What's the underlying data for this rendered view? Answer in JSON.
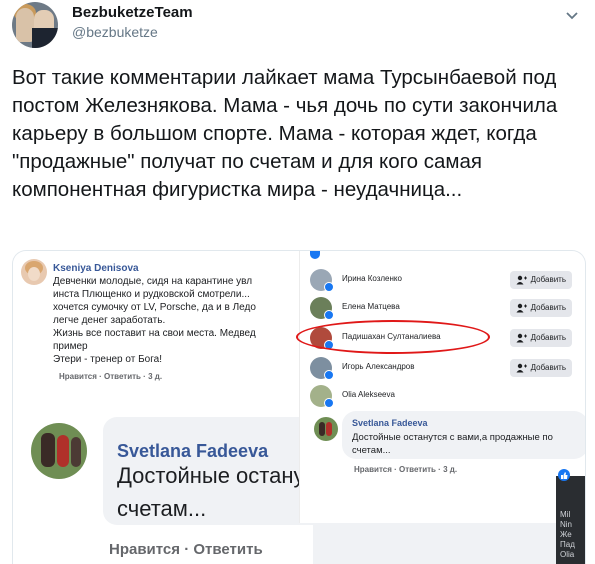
{
  "tweet": {
    "author_name": "BezbuketzeTeam",
    "author_handle": "@bezbuketze",
    "text": "Вот такие комментарии лайкает мама Турсынбаевой под постом Железнякова. Мама - чья дочь по сути закончила карьеру в большом спорте. Мама - которая ждет, когда \"продажные\" получат по счетам и для кого самая компонентная фигуристка мира - неудачница...",
    "menu_icon": "chevron-down-icon"
  },
  "media": {
    "comment1": {
      "author": "Kseniya Denisova",
      "lines": [
        "Девченки молодые, сидя на карантине увл",
        "инста Плющенко и рудковской смотрели...",
        "хочется сумочку от LV, Porsche, да и в Ледо",
        "легче денег заработать.",
        "Жизнь все поставит на свои места. Медвед",
        "пример",
        "Этери - тренер от Бога!"
      ],
      "actions": "Нравится · Ответить · 3 д."
    },
    "comment2_large": {
      "author": "Svetlana Fadeeva",
      "line1": "Достойные остану",
      "line2": "счетам...",
      "actions": "Нравится · Ответить"
    },
    "reactions": [
      {
        "name": "Ирина Козленко",
        "add": "Добавить",
        "color": "#9aa7b5"
      },
      {
        "name": "Елена Матцева",
        "add": "Добавить",
        "color": "#6b7f5a"
      },
      {
        "name": "Падишахан Султаналиева",
        "add": "Добавить",
        "color": "#b04a3c"
      },
      {
        "name": "Игорь Александров",
        "add": "Добавить",
        "color": "#7d8fa0"
      },
      {
        "name": "Olia Alekseeva",
        "add": "",
        "color": "#a3b18a"
      }
    ],
    "comment3": {
      "author": "Svetlana Fadeeva",
      "line1": "Достойные останутся с вами,а продажные по",
      "line2": "счетам...",
      "actions": "Нравится · Ответить · 3 д."
    },
    "dark_strip_lines": [
      "Mil",
      "Nin",
      "Же",
      "Пад",
      "Olia"
    ],
    "highlight_color": "#e01818"
  }
}
